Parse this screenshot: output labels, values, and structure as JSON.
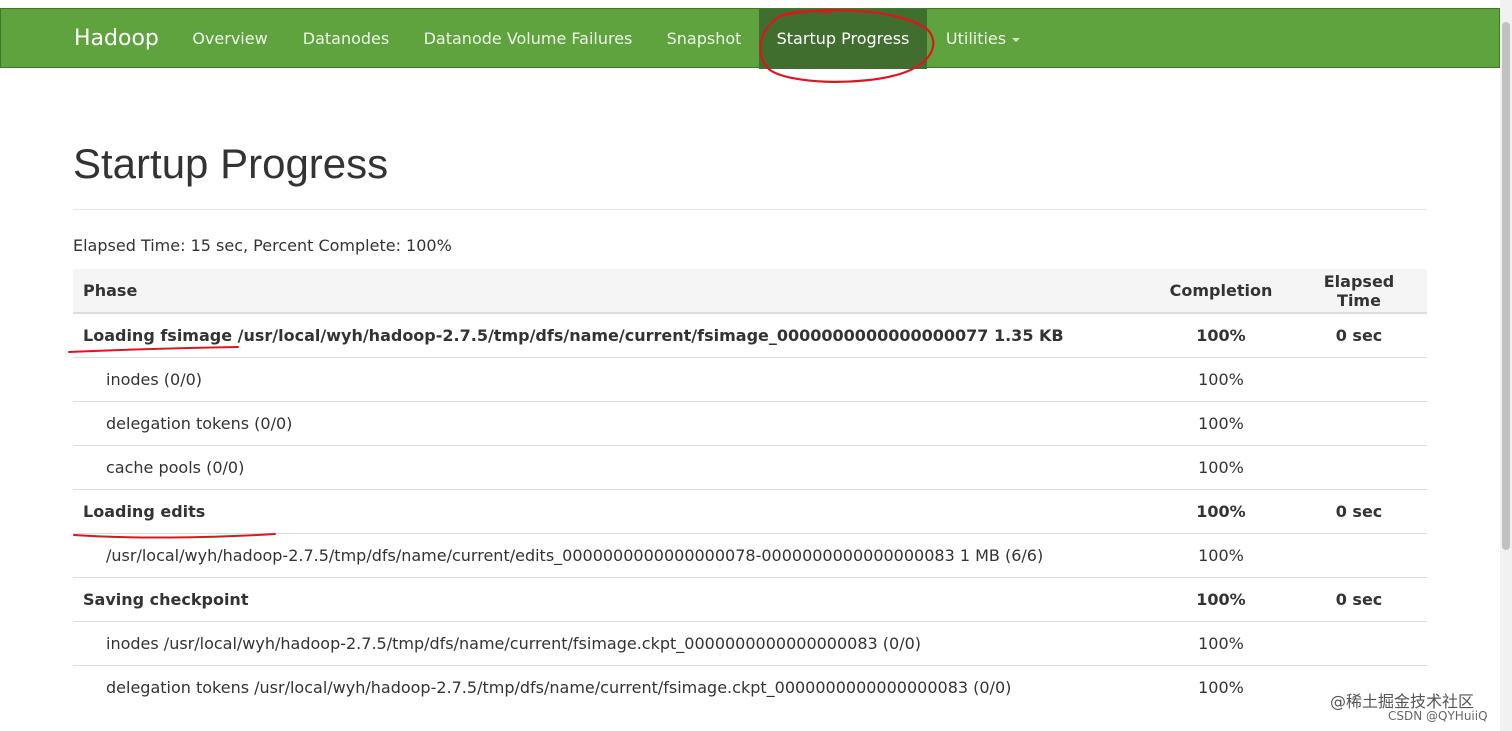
{
  "navbar": {
    "brand": "Hadoop",
    "items": [
      {
        "label": "Overview"
      },
      {
        "label": "Datanodes"
      },
      {
        "label": "Datanode Volume Failures"
      },
      {
        "label": "Snapshot"
      },
      {
        "label": "Startup Progress",
        "active": true
      },
      {
        "label": "Utilities",
        "dropdown": true
      }
    ],
    "bg_color": "#5fa33e",
    "active_color": "#3f6e2f"
  },
  "page": {
    "title": "Startup Progress",
    "summary": "Elapsed Time: 15 sec, Percent Complete: 100%"
  },
  "table": {
    "headers": [
      "Phase",
      "Completion",
      "Elapsed Time"
    ],
    "rows": [
      {
        "phase": "Loading fsimage /usr/local/wyh/hadoop-2.7.5/tmp/dfs/name/current/fsimage_0000000000000000077 1.35 KB",
        "completion": "100%",
        "elapsed": "0 sec"
      },
      {
        "step": "inodes (0/0)",
        "completion": "100%"
      },
      {
        "step": "delegation tokens (0/0)",
        "completion": "100%"
      },
      {
        "step": "cache pools (0/0)",
        "completion": "100%"
      },
      {
        "phase": "Loading edits",
        "completion": "100%",
        "elapsed": "0 sec"
      },
      {
        "step": "/usr/local/wyh/hadoop-2.7.5/tmp/dfs/name/current/edits_0000000000000000078-0000000000000000083 1 MB (6/6)",
        "completion": "100%"
      },
      {
        "phase": "Saving checkpoint",
        "completion": "100%",
        "elapsed": "0 sec"
      },
      {
        "step": "inodes /usr/local/wyh/hadoop-2.7.5/tmp/dfs/name/current/fsimage.ckpt_0000000000000000083 (0/0)",
        "completion": "100%"
      },
      {
        "step": "delegation tokens /usr/local/wyh/hadoop-2.7.5/tmp/dfs/name/current/fsimage.ckpt_0000000000000000083 (0/0)",
        "completion": "100%"
      }
    ]
  },
  "annotation_color": "#e0141e",
  "watermark": {
    "line1": "@稀土掘金技术社区",
    "line2": "CSDN @QYHuiiQ"
  }
}
